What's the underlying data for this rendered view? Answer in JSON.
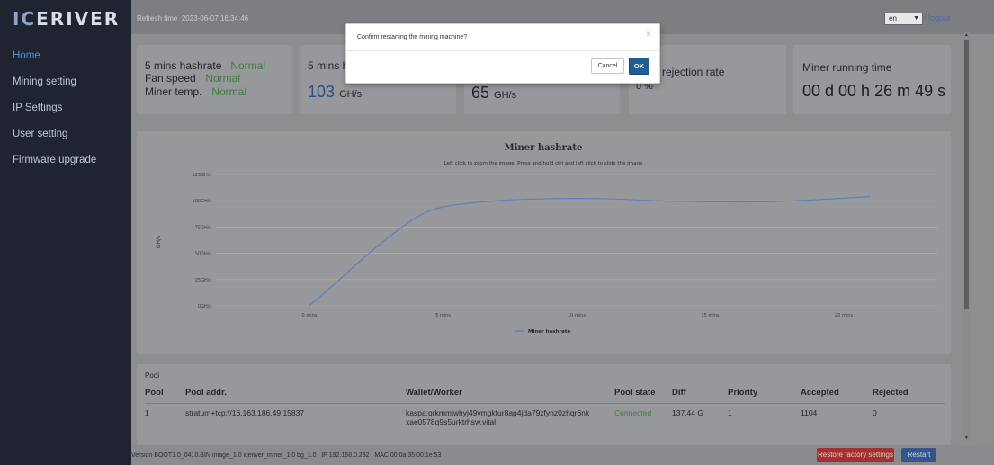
{
  "app": {
    "logo_prefix": "IC",
    "logo_rest": "ERIVER"
  },
  "sidebar": {
    "items": [
      {
        "label": "Home"
      },
      {
        "label": "Mining setting"
      },
      {
        "label": "IP Settings"
      },
      {
        "label": "User setting"
      },
      {
        "label": "Firmware upgrade"
      }
    ],
    "active_color": "#4f8fd8"
  },
  "topbar": {
    "refresh_label": "Refresh time",
    "refresh_time": "2023-06-07 16:34:46",
    "language": "en",
    "logout": "logout"
  },
  "stats": {
    "hashrate_label": "5 mins hashrate",
    "hashrate_status": "Normal",
    "fan_label": "Fan speed",
    "fan_status": "Normal",
    "temp_label": "Miner temp.",
    "temp_status": "Normal",
    "card2_title": "5 mins h",
    "card2_value": "103",
    "card2_unit": "GH/s",
    "card3_value": "65",
    "card3_unit": "GH/s",
    "card4_title": "rejection rate",
    "card4_value": "0 %",
    "card5_title": "Miner running time",
    "card5_value": "00 d 00 h 26 m 49 s",
    "status_color": "#3d7d3f"
  },
  "chart_data": {
    "type": "line",
    "title": "Miner hashrate",
    "subtitle": "Left click to zoom the image. Press and hold ctrl and left click to slide the image",
    "ylabel": "GH/s",
    "xlabel": "",
    "y_ticks": [
      "0GH/s",
      "25GH/s",
      "50GH/s",
      "75GH/s",
      "100GH/s",
      "125GH/s"
    ],
    "x_ticks": [
      "0 mins",
      "5 mins",
      "10 mins",
      "15 mins",
      "20 mins"
    ],
    "ylim": [
      0,
      125
    ],
    "xlim": [
      -3.5,
      23.5
    ],
    "grid": true,
    "legend": "bottom-center",
    "series": [
      {
        "name": "Miner hashrate",
        "color": "#5b7fb8",
        "x": [
          0,
          1,
          2,
          3,
          4,
          5,
          7,
          9,
          11,
          13,
          15,
          17,
          19,
          21
        ],
        "y": [
          0,
          22,
          45,
          66,
          84,
          94,
          100,
          102,
          102,
          100,
          99,
          99,
          101,
          104
        ]
      }
    ]
  },
  "pool": {
    "caption": "Pool",
    "headers": [
      "Pool",
      "Pool addr.",
      "Wallet/Worker",
      "Pool state",
      "Diff",
      "Priority",
      "Accepted",
      "Rejected"
    ],
    "rows": [
      {
        "pool": "1",
        "addr": "stratum+tcp://16.163.186.49:15837",
        "wallet_line1": "kaspa:qrkmmlwhyj49vmgkfur8ap4jda79zfynz0zhqr6nk",
        "wallet_line2": "xae0578q9s5urktrhsw.vital",
        "state": "Connected",
        "diff": "137.44 G",
        "priority": "1",
        "accepted": "1104",
        "rejected": "0"
      }
    ]
  },
  "footer": {
    "version_label": "Version",
    "version": "BOOT1.0_0410.BIN image_1.0 iceriver_miner_1.0 bg_1.0",
    "ip_label": "IP",
    "ip": "192.168.0.232",
    "mac_label": "MAC",
    "mac": "00:0a:35:00:1e:53",
    "restore_label": "Restore factory settings",
    "restart_label": "Restart"
  },
  "modal": {
    "message": "Confirm restarting the mining machine?",
    "cancel_label": "Cancel",
    "ok_label": "OK"
  }
}
